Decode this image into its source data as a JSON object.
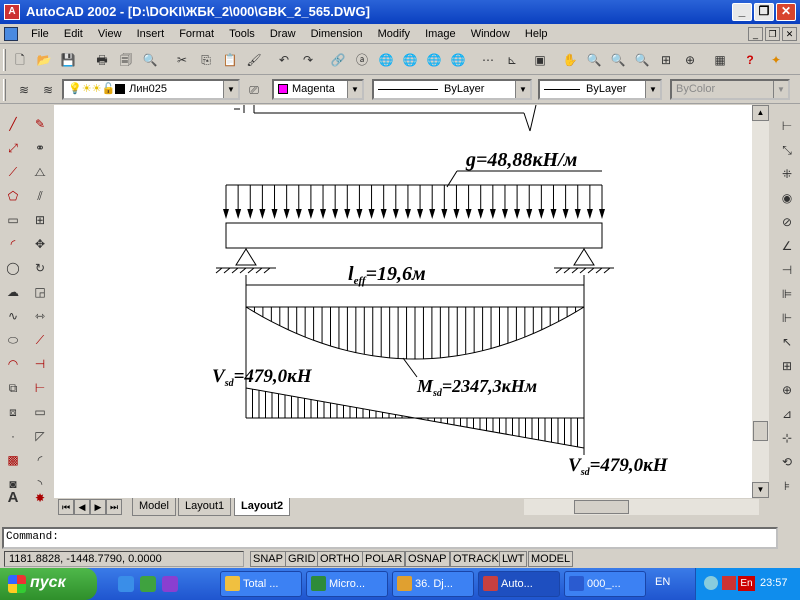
{
  "window": {
    "title": "AutoCAD 2002 - [D:\\DOKI\\ЖБК_2\\000\\GBK_2_565.DWG]",
    "minimize": "_",
    "maximize": "❐",
    "close": "✕"
  },
  "menu": [
    "File",
    "Edit",
    "View",
    "Insert",
    "Format",
    "Tools",
    "Draw",
    "Dimension",
    "Modify",
    "Image",
    "Window",
    "Help"
  ],
  "layer_toolbar": {
    "layer_name": "Лин025",
    "color_name": "Magenta",
    "color_hex": "#ff00ff",
    "linetype": "ByLayer",
    "lineweight": "ByLayer",
    "plotstyle": "ByColor"
  },
  "drawing": {
    "load_label": "g=48,88кН/м",
    "span_symbol": "l",
    "span_subscript": "eff",
    "span_value": "=19,6м",
    "moment_symbol": "M",
    "moment_subscript": "sd",
    "moment_value": "=2347,3кНм",
    "shear_left_symbol": "V",
    "shear_left_subscript": "sd",
    "shear_left_value": "=479,0кН",
    "shear_right_symbol": "V",
    "shear_right_subscript": "sd",
    "shear_right_value": "=479,0кН"
  },
  "layout_tabs": [
    "Model",
    "Layout1",
    "Layout2"
  ],
  "active_tab": "Layout2",
  "command": {
    "prompt": "Command:"
  },
  "status": {
    "coordinates": "1181.8828, -1448.7790, 0.0000",
    "modes": [
      "SNAP",
      "GRID",
      "ORTHO",
      "POLAR",
      "OSNAP",
      "OTRACK",
      "LWT",
      "MODEL"
    ]
  },
  "taskbar": {
    "start_label": "пуск",
    "tasks": [
      {
        "label": "Total ...",
        "icon_color": "#f0c040"
      },
      {
        "label": "Micro...",
        "icon_color": "#2e8b3a"
      },
      {
        "label": "36. Dj...",
        "icon_color": "#e0a030"
      },
      {
        "label": "Auto...",
        "icon_color": "#c84040"
      },
      {
        "label": "000_...",
        "icon_color": "#2a5bd0"
      }
    ],
    "language": "EN",
    "tray_lang": "En",
    "clock": "23:57"
  }
}
